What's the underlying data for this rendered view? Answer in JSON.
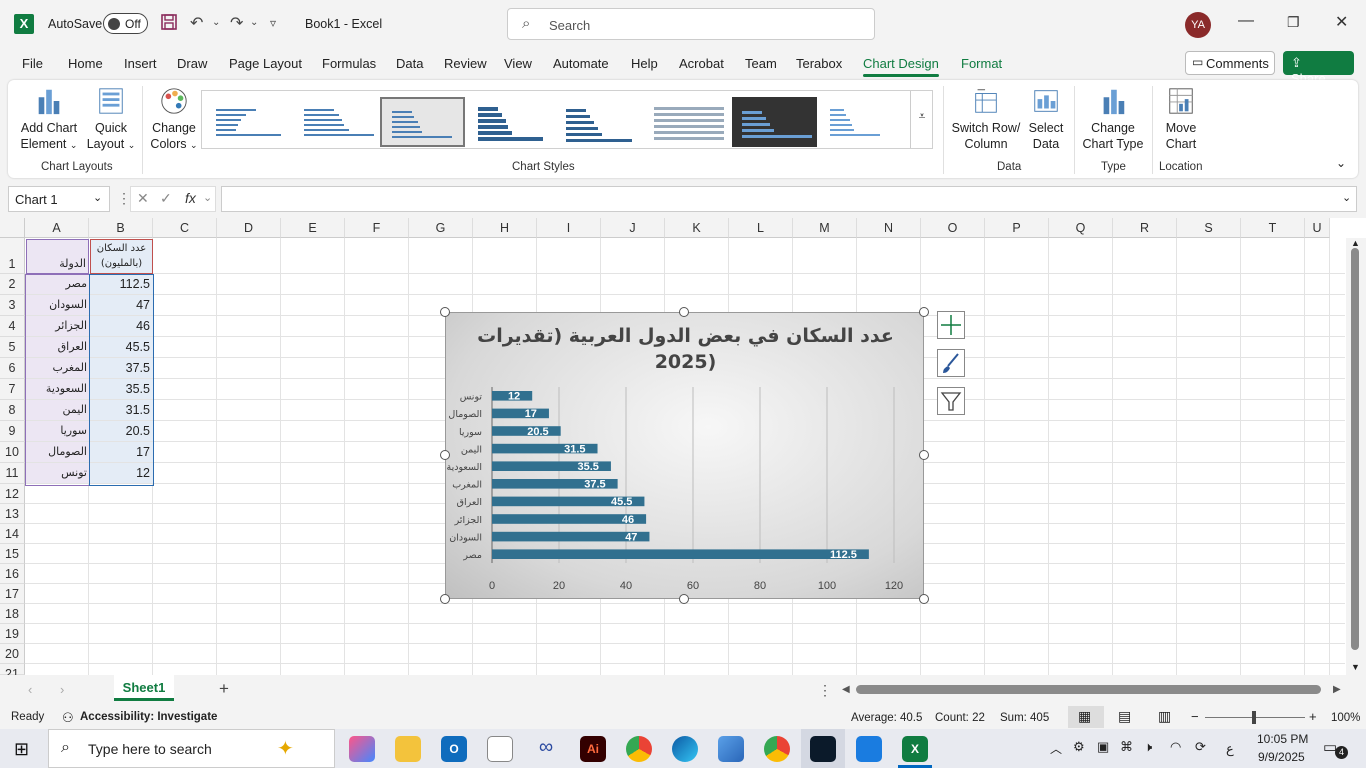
{
  "titlebar": {
    "autosave_label": "AutoSave",
    "autosave_state": "Off",
    "doc_title": "Book1 - Excel",
    "search_placeholder": "Search",
    "user_initials": "YA"
  },
  "menu": {
    "tabs": [
      "File",
      "Home",
      "Insert",
      "Draw",
      "Page Layout",
      "Formulas",
      "Data",
      "Review",
      "View",
      "Automate",
      "Help",
      "Acrobat",
      "Team",
      "Terabox",
      "Chart Design",
      "Format"
    ],
    "active_tab": "Chart Design",
    "comments_label": "Comments",
    "share_label": "Share"
  },
  "ribbon": {
    "add_chart_element": [
      "Add Chart",
      "Element"
    ],
    "quick_layout": [
      "Quick",
      "Layout"
    ],
    "change_colors": [
      "Change",
      "Colors"
    ],
    "switch_row_column": [
      "Switch Row/",
      "Column"
    ],
    "select_data": [
      "Select",
      "Data"
    ],
    "change_chart_type": [
      "Change",
      "Chart Type"
    ],
    "move_chart": [
      "Move",
      "Chart"
    ],
    "groups": {
      "chart_layouts": "Chart Layouts",
      "chart_styles": "Chart Styles",
      "data": "Data",
      "type": "Type",
      "location": "Location"
    }
  },
  "formula_bar": {
    "name_box": "Chart 1",
    "fx": "fx",
    "value": ""
  },
  "sheet": {
    "columns": [
      "A",
      "B",
      "C",
      "D",
      "E",
      "F",
      "G",
      "H",
      "I",
      "J",
      "K",
      "L",
      "M",
      "N",
      "O",
      "P",
      "Q",
      "R",
      "S",
      "T",
      "U"
    ],
    "rows": [
      "1",
      "2",
      "3",
      "4",
      "5",
      "6",
      "7",
      "8",
      "9",
      "10",
      "11",
      "12",
      "13",
      "14",
      "15",
      "16",
      "17",
      "18",
      "19",
      "20",
      "21"
    ],
    "header_a": "الدولة",
    "header_b_line1": "عدد السكان",
    "header_b_line2": "(بالمليون)",
    "data": [
      {
        "country": "مصر",
        "value": "112.5"
      },
      {
        "country": "السودان",
        "value": "47"
      },
      {
        "country": "الجزائر",
        "value": "46"
      },
      {
        "country": "العراق",
        "value": "45.5"
      },
      {
        "country": "المغرب",
        "value": "37.5"
      },
      {
        "country": "السعودية",
        "value": "35.5"
      },
      {
        "country": "اليمن",
        "value": "31.5"
      },
      {
        "country": "سوريا",
        "value": "20.5"
      },
      {
        "country": "الصومال",
        "value": "17"
      },
      {
        "country": "تونس",
        "value": "12"
      }
    ]
  },
  "chart_data": {
    "type": "bar",
    "orientation": "horizontal",
    "title": "عدد السكان في بعض الدول العربية (تقديرات 2025)",
    "title_line1": "عدد السكان في بعض الدول العربية (تقديرات",
    "title_line2": "(2025",
    "categories": [
      "تونس",
      "الصومال",
      "سوريا",
      "اليمن",
      "السعودية",
      "المغرب",
      "العراق",
      "الجزائر",
      "السودان",
      "مصر"
    ],
    "values": [
      12,
      17,
      20.5,
      31.5,
      35.5,
      37.5,
      45.5,
      46,
      47,
      112.5
    ],
    "data_labels": [
      "12",
      "17",
      "20.5",
      "31.5",
      "35.5",
      "37.5",
      "45.5",
      "46",
      "47",
      "112.5"
    ],
    "xlim": [
      0,
      120
    ],
    "xticks": [
      "0",
      "20",
      "40",
      "60",
      "80",
      "100",
      "120"
    ],
    "grid": true,
    "legend": "none",
    "bar_color": "#31708f"
  },
  "sheet_tabs": {
    "active": "Sheet1"
  },
  "status": {
    "mode": "Ready",
    "accessibility": "Accessibility: Investigate",
    "average": "Average: 40.5",
    "count": "Count: 22",
    "sum": "Sum: 405",
    "zoom": "100%"
  },
  "taskbar": {
    "search_placeholder": "Type here to search",
    "time": "10:05 PM",
    "date": "9/9/2025",
    "lang": "ع",
    "notifications": "4"
  },
  "colors": {
    "excel_green": "#107c41",
    "bar": "#31708f"
  }
}
